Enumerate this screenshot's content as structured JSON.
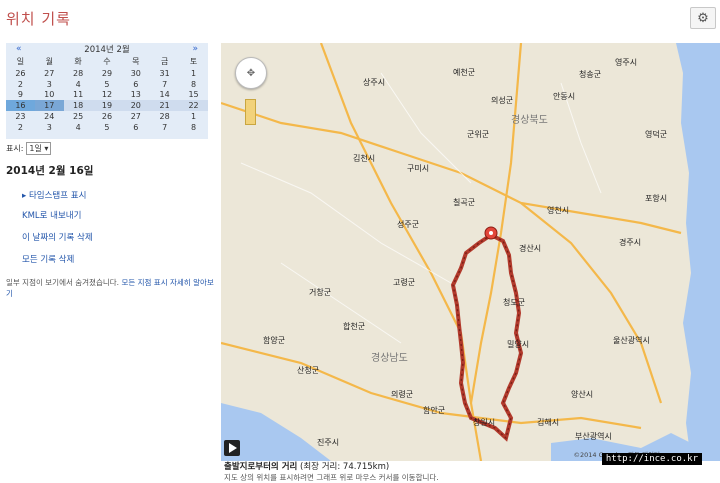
{
  "app": {
    "title": "위치 기록",
    "settings_icon": "gear-icon"
  },
  "calendar": {
    "month_label": "2014년 2월",
    "prev": "«",
    "next": "»",
    "weekdays": [
      "일",
      "월",
      "화",
      "수",
      "목",
      "금",
      "토"
    ],
    "weeks": [
      [
        "26",
        "27",
        "28",
        "29",
        "30",
        "31",
        "1"
      ],
      [
        "2",
        "3",
        "4",
        "5",
        "6",
        "7",
        "8"
      ],
      [
        "9",
        "10",
        "11",
        "12",
        "13",
        "14",
        "15"
      ],
      [
        "16",
        "17",
        "18",
        "19",
        "20",
        "21",
        "22"
      ],
      [
        "23",
        "24",
        "25",
        "26",
        "27",
        "28",
        "1"
      ],
      [
        "2",
        "3",
        "4",
        "5",
        "6",
        "7",
        "8"
      ]
    ],
    "zoom_label": "표시:",
    "zoom_value": "1일"
  },
  "day": {
    "title": "2014년 2월 16일",
    "links": {
      "timestamps": "▸ 타임스탬프 표시",
      "export_kml": "KML로 내보내기",
      "delete_day": "이 날짜의 기록 삭제",
      "delete_all": "모든 기록 삭제"
    },
    "note": "일부 지점이 보기에서 숨겨졌습니다.",
    "note_link": "모든 지점 표시 자세히 알아보기"
  },
  "map": {
    "region_labels": [
      "경상북도",
      "경상남도"
    ],
    "city_labels": [
      "상주시",
      "영주시",
      "예천군",
      "안동시",
      "의성군",
      "구미시",
      "김천시",
      "칠곡군",
      "성주군",
      "고령군",
      "합천군",
      "거창군",
      "함양군",
      "산청군",
      "진주시",
      "의령군",
      "함안군",
      "창원시",
      "김해시",
      "밀양시",
      "청도군",
      "경산시",
      "영천시",
      "경주시",
      "포항시",
      "울산광역시",
      "양산시",
      "부산광역시",
      "영덕군",
      "청송군",
      "군위군"
    ],
    "copyright": "©2014 Google - 지도 데이터",
    "route_color": "#b23a2c"
  },
  "footer": {
    "distance_label": "출발지로부터의 거리",
    "distance_value": "(최장 거리: 74.715km)",
    "hint": "지도 상의 위치를 표시하려면 그래프 위로 마우스 커서를 이동합니다.",
    "watermark": "http://ince.co.kr"
  }
}
